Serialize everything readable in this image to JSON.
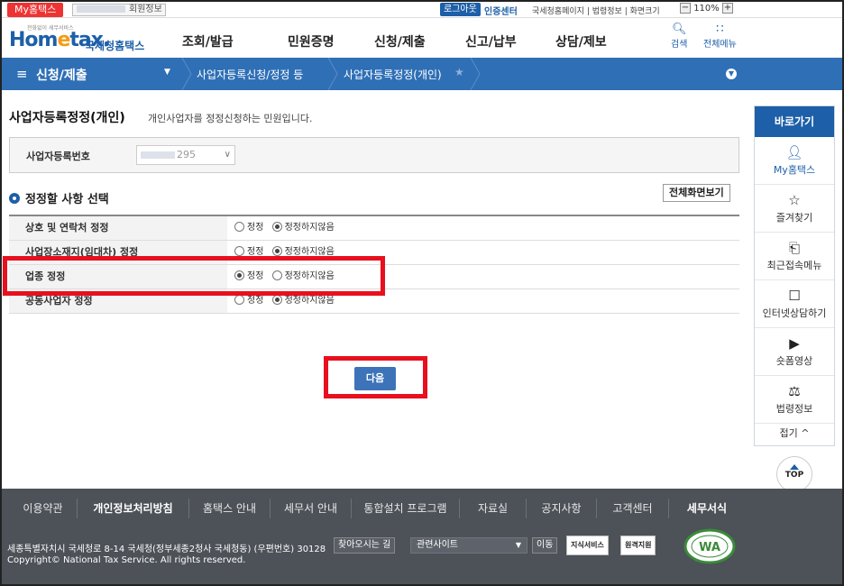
{
  "topbar": {
    "myhometax_tab": "My홈택스",
    "user_info": "회원정보",
    "logout": "로그아웃",
    "cert_center": "인증센터",
    "links": "국세청홈페이지 | 법령정보 | 화면크기",
    "zoom_minus": "−",
    "zoom_level": "110%",
    "zoom_plus": "+"
  },
  "header": {
    "logo_small": "전화없이 세무서비스",
    "logo_main_prefix": "Hom",
    "logo_main_e": "e",
    "logo_main_suffix": "tax.",
    "logo_kr": "국세청홈택스",
    "gnb": [
      "조회/발급",
      "민원증명",
      "신청/제출",
      "신고/납부",
      "상담/제보"
    ],
    "search_label": "검색",
    "allmenu_label": "전체메뉴"
  },
  "breadcrumb": {
    "level1": "신청/제출",
    "level2": "사업자등록신청/정정 등",
    "level3": "사업자등록정정(개인)"
  },
  "main": {
    "title": "사업자등록정정(개인)",
    "description": "개인사업자를 정정신청하는 민원입니다.",
    "biz_number_label": "사업자등록번호",
    "biz_number_value": "295",
    "section_title": "정정할 사항 선택",
    "fullscreen_button": "전체화면보기",
    "options": [
      {
        "label": "상호 및 연락처 정정",
        "opt_yes": "정정",
        "opt_no": "정정하지않음",
        "selected": "no"
      },
      {
        "label": "사업장소재지(임대차) 정정",
        "opt_yes": "정정",
        "opt_no": "정정하지않음",
        "selected": "no"
      },
      {
        "label": "업종 정정",
        "opt_yes": "정정",
        "opt_no": "정정하지않음",
        "selected": "yes"
      },
      {
        "label": "공동사업자 정정",
        "opt_yes": "정정",
        "opt_no": "정정하지않음",
        "selected": "no"
      }
    ],
    "next_button": "다음"
  },
  "quick_menu": {
    "title": "바로가기",
    "items": [
      {
        "label": "My홈택스",
        "icon": "person-icon"
      },
      {
        "label": "즐겨찾기",
        "icon": "star-icon"
      },
      {
        "label": "최근접속메뉴",
        "icon": "recent-icon"
      },
      {
        "label": "인터넷상담하기",
        "icon": "laptop-icon"
      },
      {
        "label": "숏폼영상",
        "icon": "play-icon"
      },
      {
        "label": "법령정보",
        "icon": "gavel-icon"
      }
    ],
    "fold": "접기 ^",
    "top": "TOP"
  },
  "footer": {
    "nav": [
      "이용약관",
      "개인정보처리방침",
      "홈택스 안내",
      "세무서 안내",
      "통합설치 프로그램",
      "자료실",
      "공지사항",
      "고객센터",
      "세무서식"
    ],
    "address": "세종특별자치시 국세청로 8-14 국세청(정부세종2청사 국세청동) (우편번호) 30128",
    "copyright": "Copyright© National Tax Service. All rights reserved.",
    "find_way": "찾아오시는 길",
    "related_sites": "관련사이트",
    "move": "이동",
    "badge1": "지식서비스",
    "badge2": "원격지원",
    "was_logo": "WA"
  },
  "colors": {
    "brand_blue": "#1d5fa8",
    "crumb_blue": "#2f6fb6",
    "highlight_red": "#e8101e",
    "footer_gray": "#4d5158"
  }
}
